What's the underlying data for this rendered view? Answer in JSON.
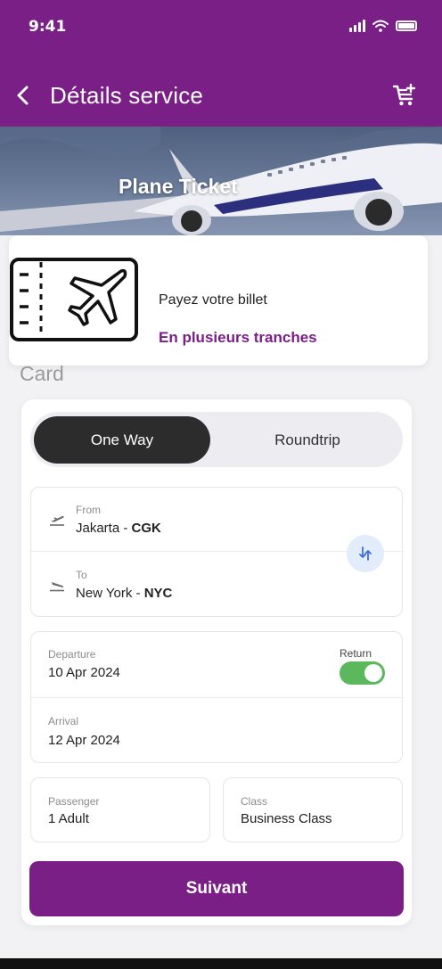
{
  "status_bar": {
    "time": "9:41"
  },
  "header": {
    "title": "Détails service"
  },
  "hero": {
    "title": "Plane Ticket"
  },
  "promo": {
    "line1": "Payez votre billet",
    "line2": "En plusieurs tranches"
  },
  "section_label": "Card",
  "trip_toggle": {
    "one_way": "One Way",
    "roundtrip": "Roundtrip",
    "selected": "One Way"
  },
  "route": {
    "from_label": "From",
    "from_city": "Jakarta",
    "from_code": "CGK",
    "to_label": "To",
    "to_city": "New York",
    "to_code": "NYC"
  },
  "dates": {
    "departure_label": "Departure",
    "departure_value": "10 Apr 2024",
    "return_label": "Return",
    "return_enabled": true,
    "arrival_label": "Arrival",
    "arrival_value": "12 Apr 2024"
  },
  "passenger": {
    "label": "Passenger",
    "value": "1 Adult"
  },
  "travel_class": {
    "label": "Class",
    "value": "Business Class"
  },
  "submit_label": "Suivant",
  "colors": {
    "brand": "#7a1f85",
    "toggle_active": "#2c2c2c",
    "switch_on": "#5cb85c",
    "swap_bg": "#e3ecfb"
  },
  "icons": [
    "back-icon",
    "cart-add-icon",
    "ticket-plane-icon",
    "takeoff-icon",
    "landing-icon",
    "swap-icon"
  ]
}
